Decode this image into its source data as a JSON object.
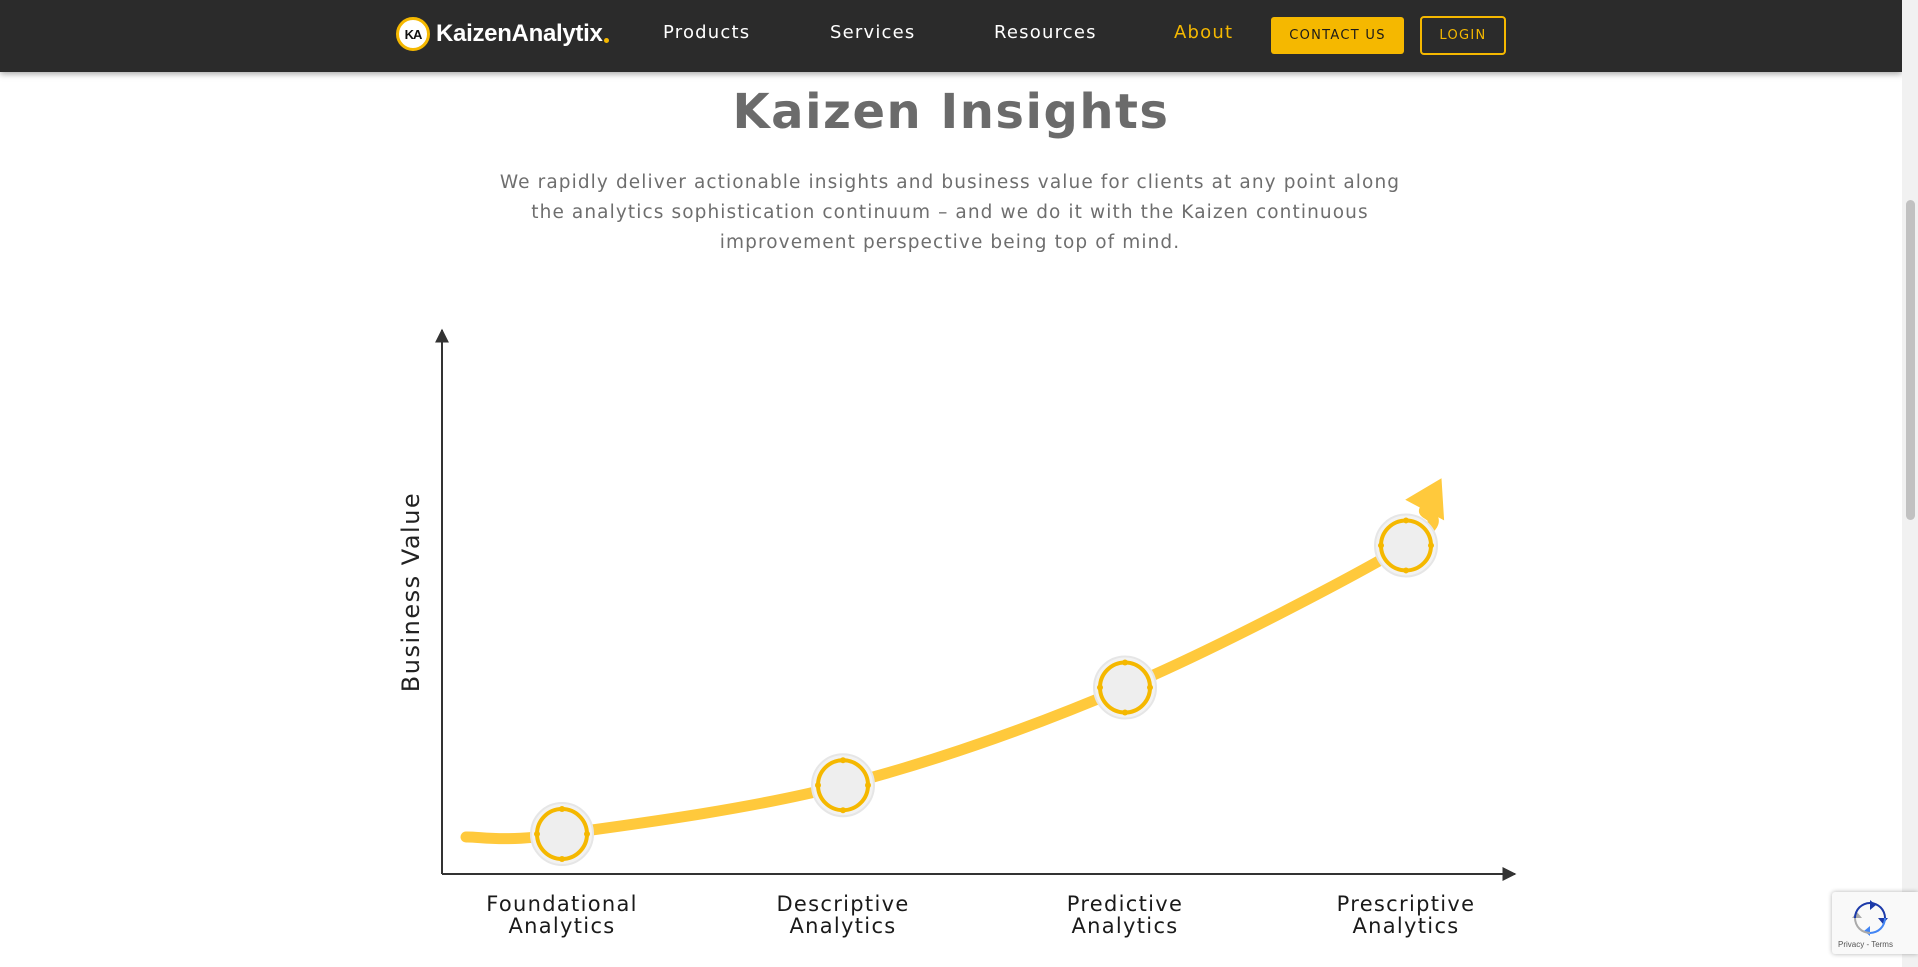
{
  "brand": {
    "name": "KaizenAnalytix",
    "mark": "KA",
    "accent": "#f5b800"
  },
  "nav": {
    "items": [
      {
        "label": "Products"
      },
      {
        "label": "Services"
      },
      {
        "label": "Resources"
      },
      {
        "label": "About",
        "active": true
      }
    ],
    "contact_label": "CONTACT US",
    "login_label": "LOGIN"
  },
  "hero": {
    "title": "Kaizen Insights",
    "description_lines": [
      "We rapidly deliver actionable insights and business value for clients at any point along",
      "the analytics sophistication continuum – and we do it with the Kaizen continuous",
      "improvement perspective being top of mind."
    ]
  },
  "chart_data": {
    "type": "line",
    "ylabel": "Business Value",
    "xlabel": "",
    "categories": [
      [
        "Foundational",
        "Analytics"
      ],
      [
        "Descriptive",
        "Analytics"
      ],
      [
        "Predictive",
        "Analytics"
      ],
      [
        "Prescriptive",
        "Analytics"
      ]
    ],
    "values": [
      0.09,
      0.2,
      0.42,
      0.74
    ],
    "ylim": [
      0,
      1
    ],
    "grid": false,
    "curve_color": "#ffc93c",
    "marker_ring_color": "#f5b800",
    "marker_fill": "#eeeeee",
    "arrow_end": true
  },
  "recaptcha": {
    "footer": "Privacy - Terms"
  }
}
